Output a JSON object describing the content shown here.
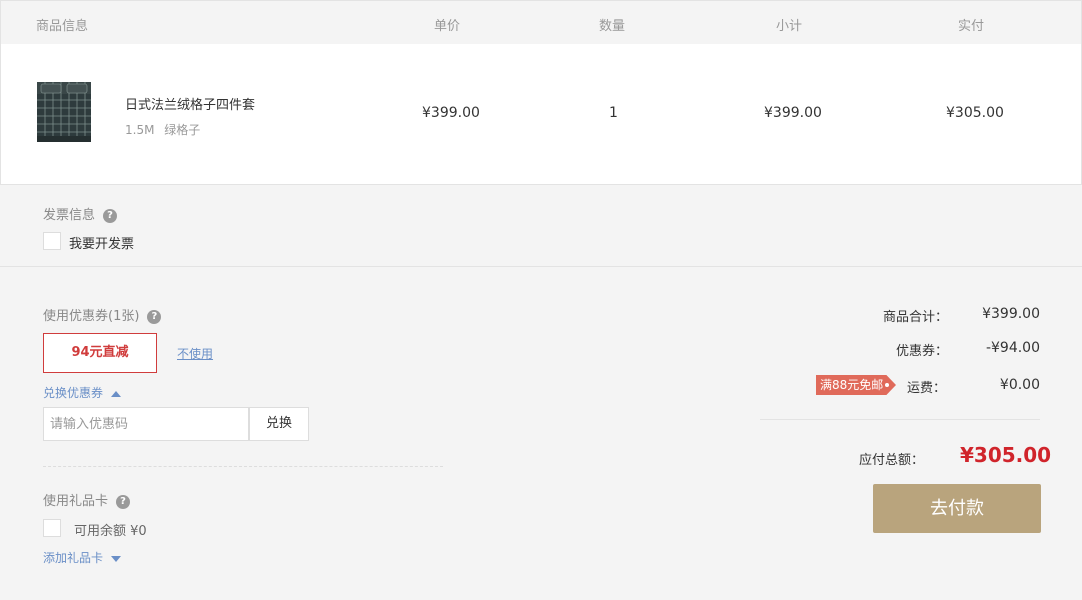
{
  "table_header": {
    "product": "商品信息",
    "price": "单价",
    "quantity": "数量",
    "subtotal": "小计",
    "paid": "实付"
  },
  "product": {
    "name": "日式法兰绒格子四件套",
    "size": "1.5M",
    "color": "绿格子",
    "price": "¥399.00",
    "quantity": "1",
    "subtotal": "¥399.00",
    "paid": "¥305.00",
    "image_icon": "bedding-product-image"
  },
  "invoice": {
    "title": "发票信息",
    "help_icon": "?",
    "checkbox_label": "我要开发票"
  },
  "coupon": {
    "title": "使用优惠券(1张)",
    "help_icon": "?",
    "selected": "94元直减",
    "not_use": "不使用",
    "exchange_toggle": "兑换优惠券",
    "code_placeholder": "请输入优惠码",
    "exchange_button": "兑换"
  },
  "gift_card": {
    "title": "使用礼品卡",
    "help_icon": "?",
    "balance_label": "可用余额 ¥0",
    "add_toggle": "添加礼品卡"
  },
  "summary": {
    "goods_total_label": "商品合计：",
    "goods_total_value": "¥399.00",
    "coupon_label": "优惠券：",
    "coupon_value": "-¥94.00",
    "free_shipping_tag": "满88元免邮",
    "shipping_label": "运费：",
    "shipping_value": "¥0.00",
    "total_label": "应付总额：",
    "total_value": "¥305.00",
    "pay_button": "去付款"
  },
  "colors": {
    "accent_red": "#d0242b",
    "pay_button": "#b9a47d",
    "link_blue": "#6a8fc7",
    "tag_red": "#e06a5a"
  }
}
